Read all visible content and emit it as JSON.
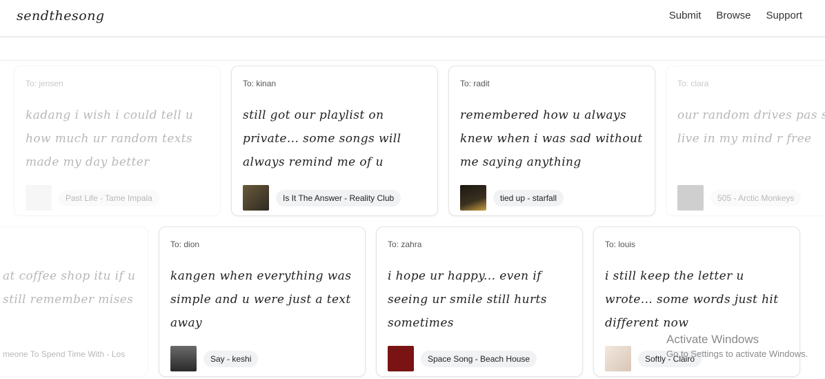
{
  "header": {
    "logo": "sendthesong",
    "nav": {
      "submit": "Submit",
      "browse": "Browse",
      "support": "Support"
    }
  },
  "row1": [
    {
      "to_prefix": "To:",
      "to": "jensen",
      "message": "kadang i wish i could tell u how much ur random texts made my day better",
      "song": "Past Life - Tame Impala",
      "thumb": "#e8e6e6"
    },
    {
      "to_prefix": "To:",
      "to": "kinan",
      "message": "still got our playlist on private... some songs will always remind me of u",
      "song": "Is It The Answer - Reality Club",
      "thumb": "#5a4a32"
    },
    {
      "to_prefix": "To:",
      "to": "radit",
      "message": "remembered how u always knew when i was sad without me saying anything",
      "song": "tied up - starfall",
      "thumb": "#2a2418"
    },
    {
      "to_prefix": "To:",
      "to": "clara",
      "message": "our random drives pas still live in my mind r free",
      "song": "505 - Arctic Monkeys",
      "thumb": "#6e6e6e"
    }
  ],
  "row2": [
    {
      "to_prefix": "",
      "to": "",
      "message": "at coffee shop itu if u still remember mises",
      "song": "meone To Spend Time With - Los",
      "thumb": ""
    },
    {
      "to_prefix": "To:",
      "to": "dion",
      "message": "kangen when everything was simple and u were just a text away",
      "song": "Say - keshi",
      "thumb": "#4a4a4a"
    },
    {
      "to_prefix": "To:",
      "to": "zahra",
      "message": "i hope ur happy... even if seeing ur smile still hurts sometimes",
      "song": "Space Song - Beach House",
      "thumb": "#7a1414"
    },
    {
      "to_prefix": "To:",
      "to": "louis",
      "message": "i still keep the letter u wrote... some words just hit different now",
      "song": "Softly - Clairo",
      "thumb": "#e9ddd2"
    }
  ],
  "watermark": {
    "title": "Activate Windows",
    "subtitle": "Go to Settings to activate Windows."
  }
}
